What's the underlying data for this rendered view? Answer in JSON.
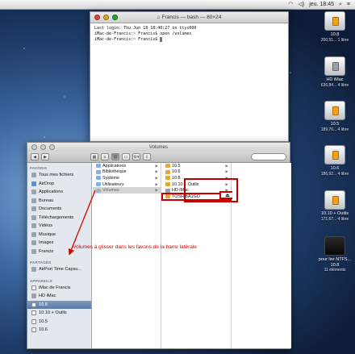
{
  "menubar": {
    "time": "jeu. 18:45"
  },
  "terminal": {
    "title": "Francis — bash — 80×24",
    "lines": [
      "Last login: Thu Jun 18 18:40:27 on ttys000",
      "iMac-de-Francis:~ Francis$ open /volumes",
      "iMac-de-Francis:~ Francis$ "
    ]
  },
  "desktop": [
    {
      "name": "10.8",
      "sub": "200,51... 1 libre"
    },
    {
      "name": "HD iMac",
      "sub": "636,84... 4 libre"
    },
    {
      "name": "10.5",
      "sub": "189,76... 4 libre"
    },
    {
      "name": "10.6",
      "sub": "186,92... 4 libre"
    },
    {
      "name": "10.10 + Outils",
      "sub": "171,67... 4 libre"
    },
    {
      "name": "pour lire NTFS... 10.8",
      "sub": "11 éléments"
    }
  ],
  "finder": {
    "title": "Volumes",
    "sidebar": {
      "favoris_header": "FAVORIS",
      "favoris": [
        "Tous mes fichiers",
        "AirDrop",
        "Applications",
        "Bureau",
        "Documents",
        "Téléchargements",
        "Vidéos",
        "Musique",
        "Images",
        "Francis"
      ],
      "partages_header": "PARTAGÉS",
      "partages": [
        "AirPort Time Capsu..."
      ],
      "appareils_header": "APPAREILS",
      "appareils": [
        "iMac de Francis",
        "HD iMac",
        "10.8",
        "10.10 + Outils",
        "10.5",
        "10.6"
      ]
    },
    "col1": [
      "Applications",
      "Bibliothèque",
      "Système",
      "Utilisateurs",
      "Volumes"
    ],
    "col2": [
      "10.5",
      "10.6",
      "10.8",
      "10.10 + Outils",
      "HD iMac",
      "TOSHIBA1GO"
    ],
    "eject": "⏏"
  },
  "annotation": "Volumes à glisser dans les favoris de la barre latérale"
}
